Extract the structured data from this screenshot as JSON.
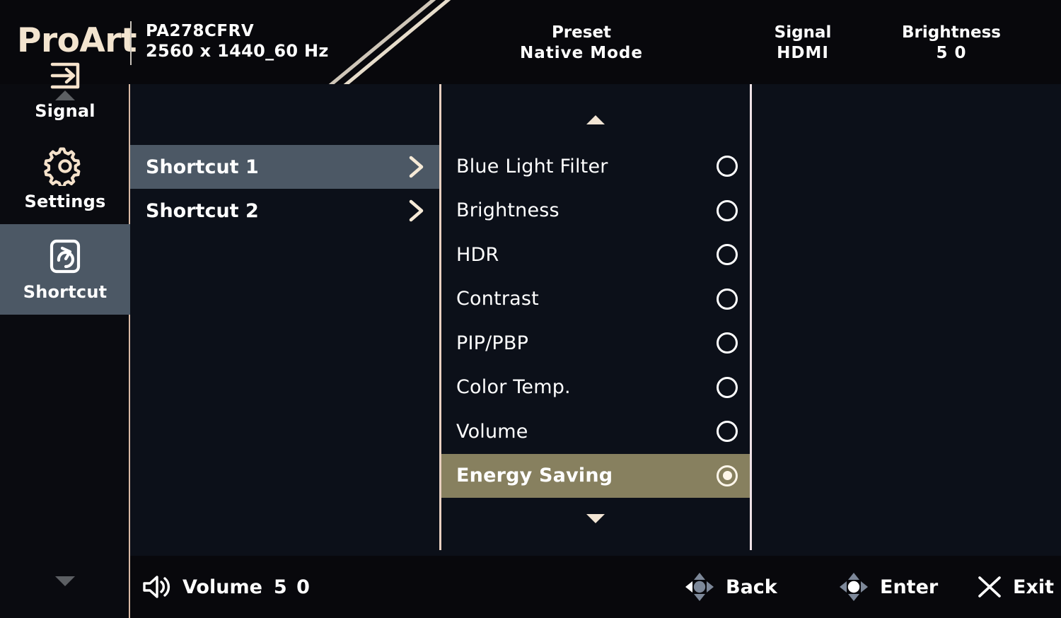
{
  "header": {
    "brand": "ProArt",
    "model_name": "PA278CFRV",
    "model_resolution": "2560 x 1440_60 Hz",
    "columns": [
      {
        "label": "Preset",
        "value": "Native Mode"
      },
      {
        "label": "Signal",
        "value": "HDMI"
      },
      {
        "label": "Brightness",
        "value": "5 0"
      }
    ]
  },
  "sidebar": {
    "items": [
      {
        "label": "Signal",
        "icon": "signal-input-icon",
        "selected": false
      },
      {
        "label": "Settings",
        "icon": "gear-icon",
        "selected": false
      },
      {
        "label": "Shortcut",
        "icon": "shortcut-rotate-icon",
        "selected": true
      }
    ]
  },
  "shortcut_panel": {
    "items": [
      {
        "label": "Shortcut 1",
        "selected": true
      },
      {
        "label": "Shortcut 2",
        "selected": false
      }
    ]
  },
  "options_panel": {
    "items": [
      {
        "label": "Blue Light Filter",
        "selected": false
      },
      {
        "label": "Brightness",
        "selected": false
      },
      {
        "label": "HDR",
        "selected": false
      },
      {
        "label": "Contrast",
        "selected": false
      },
      {
        "label": "PIP/PBP",
        "selected": false
      },
      {
        "label": "Color Temp.",
        "selected": false
      },
      {
        "label": "Volume",
        "selected": false
      },
      {
        "label": "Energy Saving",
        "selected": true
      }
    ]
  },
  "bottom_bar": {
    "volume_label": "Volume",
    "volume_value": "5 0",
    "actions": [
      {
        "label": "Back",
        "icon": "joystick-left-icon"
      },
      {
        "label": "Enter",
        "icon": "joystick-center-icon"
      },
      {
        "label": "Exit",
        "icon": "close-x-icon"
      }
    ]
  },
  "colors": {
    "brand": "#f3e4cf",
    "header_bg": "#08080c",
    "panel_bg": "#0c1019",
    "nav_highlight": "#4c5865",
    "option_highlight": "#87805f",
    "divider": "#e8cfc0"
  }
}
